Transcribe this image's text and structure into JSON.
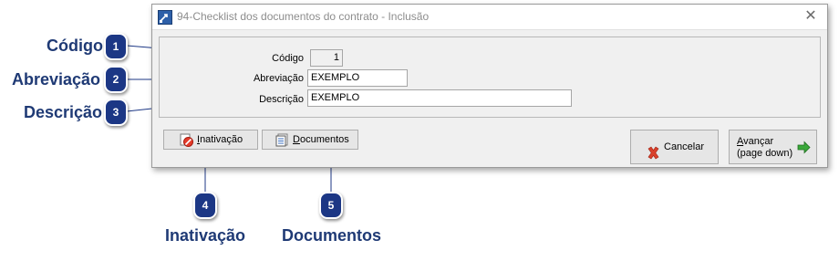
{
  "window": {
    "title": "94-Checklist dos documentos do contrato - Inclusão",
    "close_glyph": "✕"
  },
  "form": {
    "codigo_label": "Código",
    "codigo_value": "1",
    "abreviacao_label": "Abreviação",
    "abreviacao_value": "EXEMPLO",
    "descricao_label": "Descrição",
    "descricao_value": "EXEMPLO"
  },
  "buttons": {
    "inativacao_first": "I",
    "inativacao_rest": "nativação",
    "documentos_first": "D",
    "documentos_rest": "ocumentos",
    "cancelar": "Cancelar",
    "avancar_first": "A",
    "avancar_rest": "vançar",
    "avancar_sub": "(page down)"
  },
  "callouts": [
    {
      "number": "1",
      "label": "Código"
    },
    {
      "number": "2",
      "label": "Abreviação"
    },
    {
      "number": "3",
      "label": "Descrição"
    },
    {
      "number": "4",
      "label": "Inativação"
    },
    {
      "number": "5",
      "label": "Documentos"
    }
  ],
  "colors": {
    "callout_text": "#1f3a75",
    "badge": "#1c3785",
    "cancel_icon": "#d9402b",
    "next_arrow": "#3aa83a"
  },
  "icons": {
    "app": "window-edit-icon",
    "close": "close-icon",
    "inativacao": "deactivate-icon",
    "documentos": "documents-icon",
    "cancelar": "cancel-x-icon",
    "avancar": "green-arrow-right-icon"
  }
}
